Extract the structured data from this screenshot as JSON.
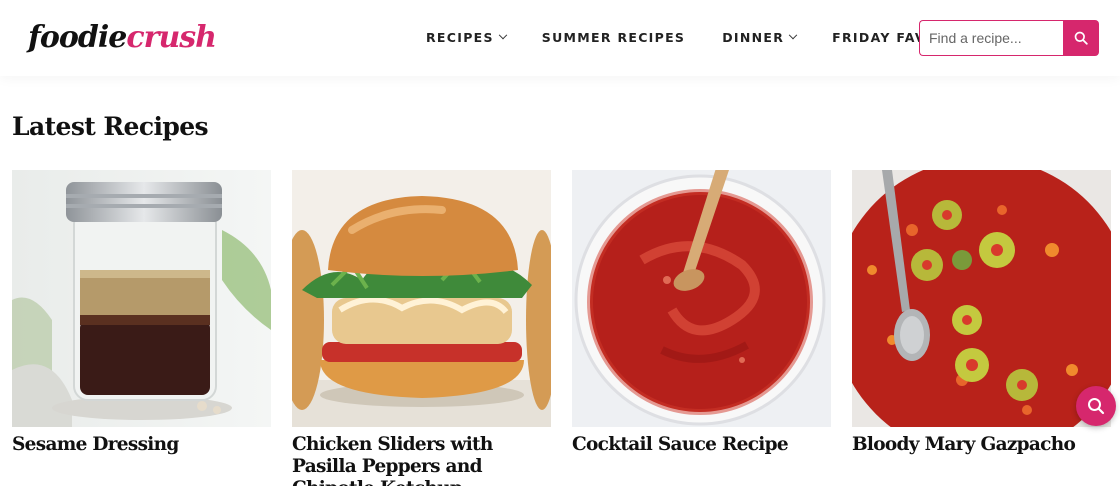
{
  "header": {
    "logo_part1": "foodie",
    "logo_part2": "crush",
    "nav": [
      {
        "label": "RECIPES"
      },
      {
        "label": "SUMMER RECIPES"
      },
      {
        "label": "DINNER"
      },
      {
        "label": "FRIDAY FAVES"
      }
    ],
    "search_placeholder": "Find a recipe..."
  },
  "section_title": "Latest Recipes",
  "recipes": [
    {
      "title": "Sesame Dressing"
    },
    {
      "title": "Chicken Sliders with Pasilla Peppers and Chipotle Ketchup"
    },
    {
      "title": "Cocktail Sauce Recipe"
    },
    {
      "title": "Bloody Mary Gazpacho"
    }
  ],
  "colors": {
    "brand": "#d6276d",
    "text": "#111111"
  },
  "icons": {
    "search": "search-icon",
    "chevron": "chevron-down-icon"
  }
}
